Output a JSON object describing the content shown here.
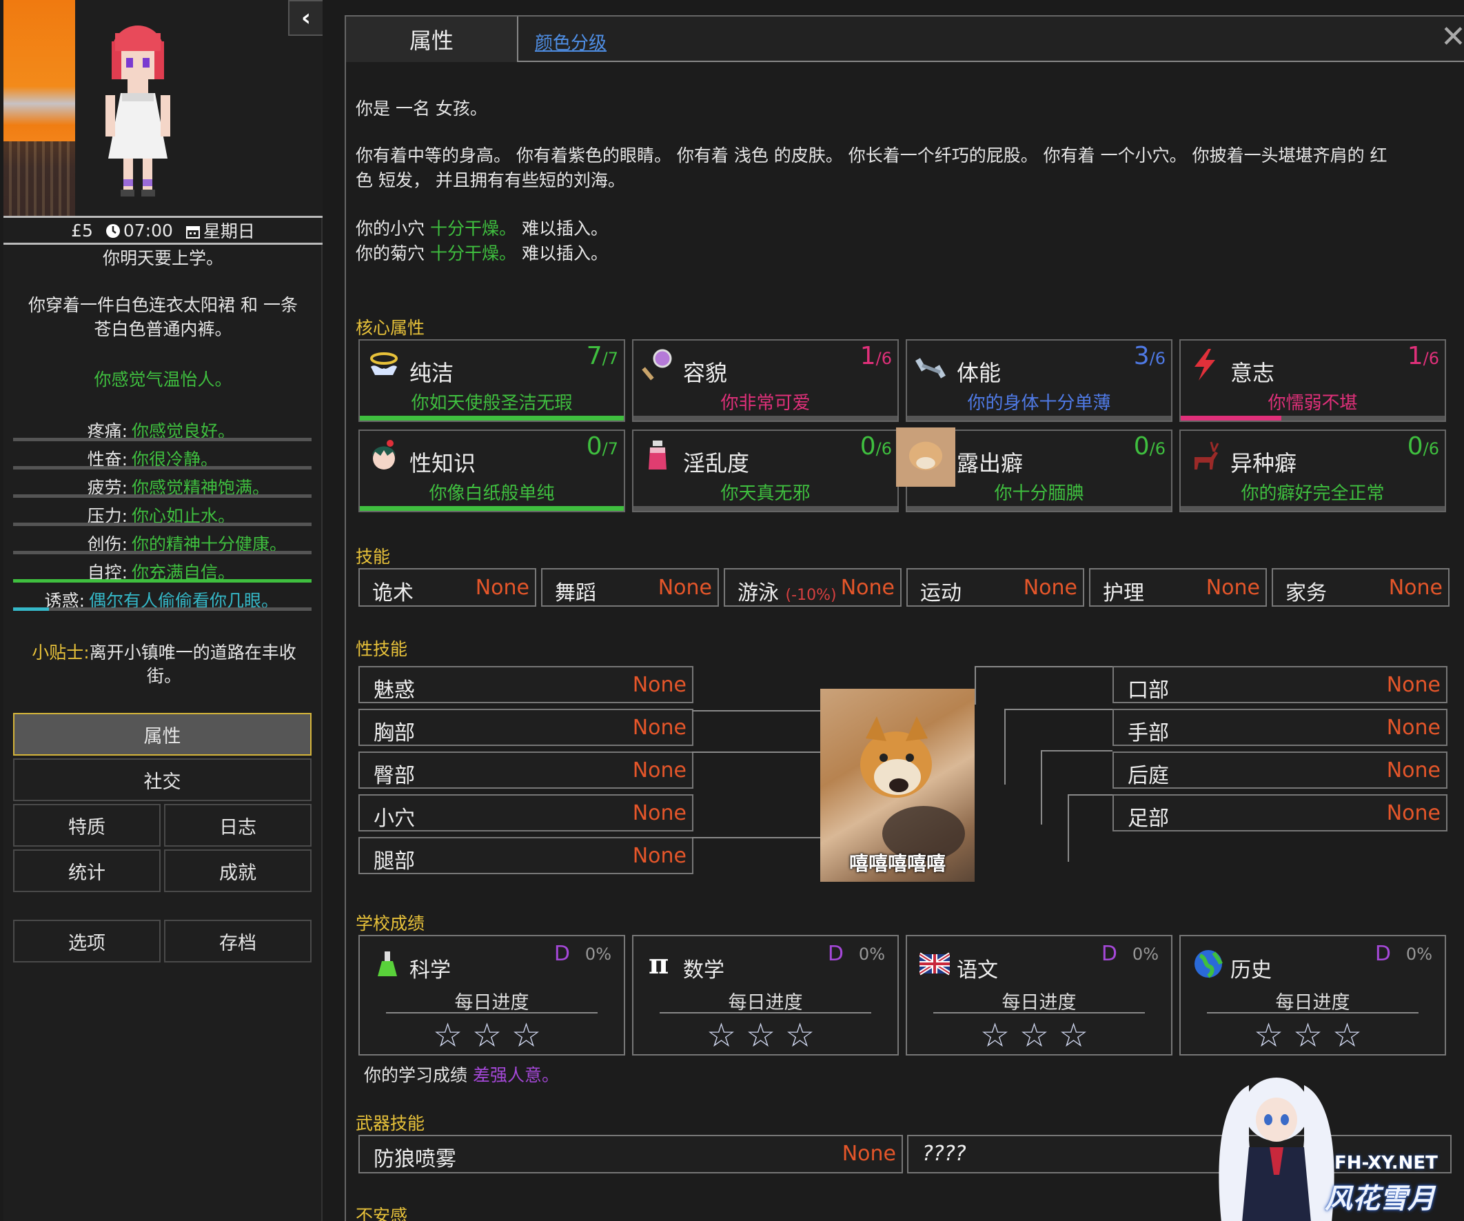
{
  "sidebar": {
    "collapse_icon": "chevron-left-icon",
    "status": {
      "money": "£5",
      "time": "07:00",
      "weekday": "星期日"
    },
    "school_notice": "你明天要上学。",
    "clothing_line1": "你穿着一件白色连衣太阳裙 和 一条",
    "clothing_line2": "苍白色普通内裤。",
    "weather": "你感觉气温怡人。",
    "stats": [
      {
        "label": "疼痛:",
        "value": "你感觉良好。",
        "fill": 0,
        "color": "#3fbf3f"
      },
      {
        "label": "性奋:",
        "value": "你很冷静。",
        "fill": 0,
        "color": "#3fbf3f"
      },
      {
        "label": "疲劳:",
        "value": "你感觉精神饱满。",
        "fill": 0,
        "color": "#3fbf3f"
      },
      {
        "label": "压力:",
        "value": "你心如止水。",
        "fill": 0,
        "color": "#3fbf3f"
      },
      {
        "label": "创伤:",
        "value": "你的精神十分健康。",
        "fill": 0,
        "color": "#3fbf3f"
      },
      {
        "label": "自控:",
        "value": "你充满自信。",
        "fill": 1,
        "color": "#3fbf3f"
      },
      {
        "label": "诱惑:",
        "value": "偶尔有人偷偷看你几眼。",
        "fill": 0.12,
        "color": "#35b8c8"
      }
    ],
    "tip_key": "小贴士:",
    "tip_text": "离开小镇唯一的道路在丰收街。",
    "nav": {
      "attributes": "属性",
      "social": "社交",
      "traits": "特质",
      "journal": "日志",
      "stats": "统计",
      "achievements": "成就",
      "options": "选项",
      "saves": "存档"
    }
  },
  "panel": {
    "tab_attributes": "属性",
    "tab_color": "颜色分级",
    "close_icon": "close-icon",
    "intro": "你是 一名 女孩。",
    "desc_line1": "你有着中等的身高。 你有着紫色的眼睛。 你有着 浅色 的皮肤。 你长着一个纤巧的屁股。 你有着 一个小穴。 你披着一头堪堪齐肩的 红",
    "desc_line2": "色 短发， 并且拥有有些短的刘海。",
    "vagina_prefix": "你的小穴",
    "vagina_state": "十分干燥。",
    "vagina_suffix": "难以插入。",
    "anus_prefix": "你的菊穴",
    "anus_state": "十分干燥。",
    "anus_suffix": "难以插入。",
    "sections": {
      "core": "核心属性",
      "skills": "技能",
      "sex_skills": "性技能",
      "school": "学校成绩",
      "weapons": "武器技能",
      "insecurity": "不安感"
    },
    "core": [
      {
        "name": "纯洁",
        "score": "7",
        "max": "/7",
        "desc": "你如天使般圣洁无瑕",
        "score_color": "#3fbf3f",
        "desc_color": "#3fbf3f",
        "fill": 1,
        "bar_color": "#3fbf3f",
        "icon": "halo-icon"
      },
      {
        "name": "容貌",
        "score": "1",
        "max": "/6",
        "desc": "你非常可爱",
        "score_color": "#e0307a",
        "desc_color": "#e0307a",
        "fill": 0,
        "bar_color": "#e0307a",
        "icon": "mirror-icon"
      },
      {
        "name": "体能",
        "score": "3",
        "max": "/6",
        "desc": "你的身体十分单薄",
        "score_color": "#4f7ae6",
        "desc_color": "#4f7ae6",
        "fill": 0,
        "bar_color": "#4f7ae6",
        "icon": "dumbbell-icon"
      },
      {
        "name": "意志",
        "score": "1",
        "max": "/6",
        "desc": "你懦弱不堪",
        "score_color": "#e0307a",
        "desc_color": "#e0307a",
        "fill": 0.38,
        "bar_color": "#e0307a",
        "icon": "lightning-icon"
      },
      {
        "name": "性知识",
        "score": "0",
        "max": "/7",
        "desc": "你像白纸般单纯",
        "score_color": "#3fbf3f",
        "desc_color": "#3fbf3f",
        "fill": 1,
        "bar_color": "#3fbf3f",
        "icon": "face-icon"
      },
      {
        "name": "淫乱度",
        "score": "0",
        "max": "/6",
        "desc": "你天真无邪",
        "score_color": "#3fbf3f",
        "desc_color": "#3fbf3f",
        "fill": 0,
        "bar_color": "#3fbf3f",
        "icon": "potion-icon"
      },
      {
        "name": "露出癖",
        "score": "0",
        "max": "/6",
        "desc": "你十分腼腆",
        "score_color": "#3fbf3f",
        "desc_color": "#3fbf3f",
        "fill": 0,
        "bar_color": "#3fbf3f",
        "icon": "dog-icon"
      },
      {
        "name": "异种癖",
        "score": "0",
        "max": "/6",
        "desc": "你的癖好完全正常",
        "score_color": "#3fbf3f",
        "desc_color": "#3fbf3f",
        "fill": 0,
        "bar_color": "#3fbf3f",
        "icon": "deer-icon"
      }
    ],
    "skills": [
      {
        "name": "诡术",
        "mod": "",
        "value": "None"
      },
      {
        "name": "舞蹈",
        "mod": "",
        "value": "None"
      },
      {
        "name": "游泳",
        "mod": "(-10%)",
        "value": "None"
      },
      {
        "name": "运动",
        "mod": "",
        "value": "None"
      },
      {
        "name": "护理",
        "mod": "",
        "value": "None"
      },
      {
        "name": "家务",
        "mod": "",
        "value": "None"
      }
    ],
    "sex_left": [
      {
        "name": "魅惑",
        "value": "None"
      },
      {
        "name": "胸部",
        "value": "None"
      },
      {
        "name": "臀部",
        "value": "None"
      },
      {
        "name": "小穴",
        "value": "None"
      },
      {
        "name": "腿部",
        "value": "None"
      }
    ],
    "sex_right": [
      {
        "name": "口部",
        "value": "None"
      },
      {
        "name": "手部",
        "value": "None"
      },
      {
        "name": "后庭",
        "value": "None"
      },
      {
        "name": "足部",
        "value": "None"
      }
    ],
    "meme_caption": "嘻嘻嘻嘻嘻",
    "school": [
      {
        "name": "科学",
        "grade": "D",
        "pct": "0%",
        "daily": "每日进度",
        "stars": "☆☆☆",
        "icon": "flask-icon"
      },
      {
        "name": "数学",
        "grade": "D",
        "pct": "0%",
        "daily": "每日进度",
        "stars": "☆☆☆",
        "icon": "pi-icon"
      },
      {
        "name": "语文",
        "grade": "D",
        "pct": "0%",
        "daily": "每日进度",
        "stars": "☆☆☆",
        "icon": "flag-icon"
      },
      {
        "name": "历史",
        "grade": "D",
        "pct": "0%",
        "daily": "每日进度",
        "stars": "☆☆☆",
        "icon": "globe-icon"
      }
    ],
    "school_summary_prefix": "你的学习成绩",
    "school_summary_value": "差强人意。",
    "weapons": [
      {
        "name": "防狼喷雾",
        "value": "None"
      },
      {
        "name": "????",
        "value": ""
      }
    ],
    "watermark_site": "FH-XY.NET",
    "watermark_name": "风花雪月"
  }
}
